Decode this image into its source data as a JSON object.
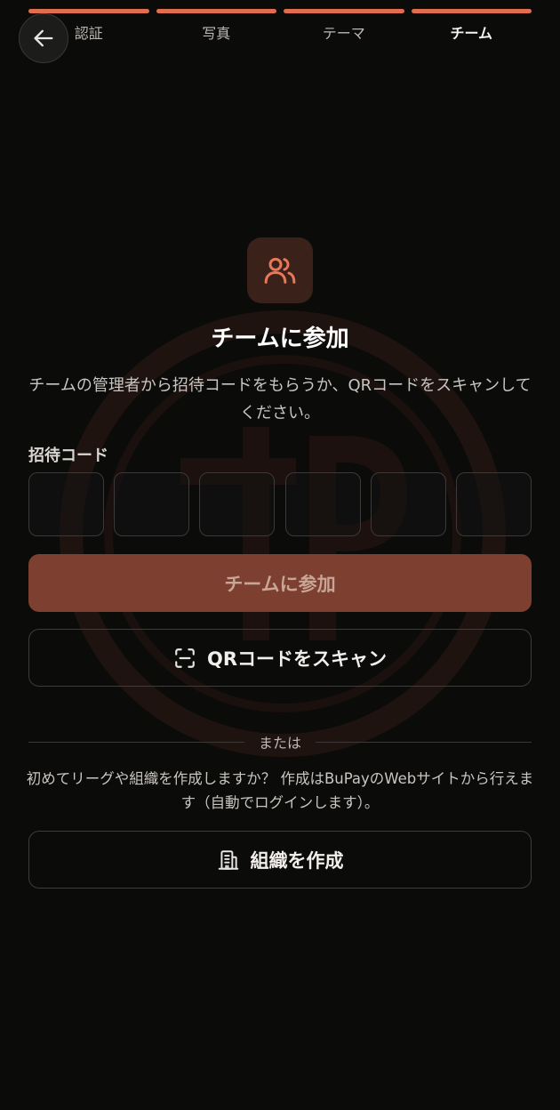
{
  "progress": {
    "steps": [
      "認証",
      "写真",
      "テーマ",
      "チーム"
    ],
    "active_index": 3,
    "fraction_complete": 1.0,
    "accent_color": "#e06d4d"
  },
  "nav": {
    "back_icon": "arrow-left-icon"
  },
  "hero": {
    "icon": "users-icon",
    "title": "チームに参加",
    "subtitle": "チームの管理者から招待コードをもらうか、QRコードをスキャンしてください。"
  },
  "invite": {
    "label": "招待コード",
    "digits": [
      "",
      "",
      "",
      "",
      "",
      ""
    ]
  },
  "buttons": {
    "join_label": "チームに参加",
    "scan_label": "QRコードをスキャン",
    "scan_icon": "scan-icon",
    "create_label": "組織を作成",
    "create_icon": "building-icon"
  },
  "divider_text": "または",
  "info_text": "初めてリーグや組織を作成しますか？ 作成はBuPayのWebサイトから行えます（自動でログインします）。",
  "colors": {
    "background": "#0b0b0a",
    "accent": "#e06d4d",
    "join_button_disabled": "#7d4030"
  }
}
